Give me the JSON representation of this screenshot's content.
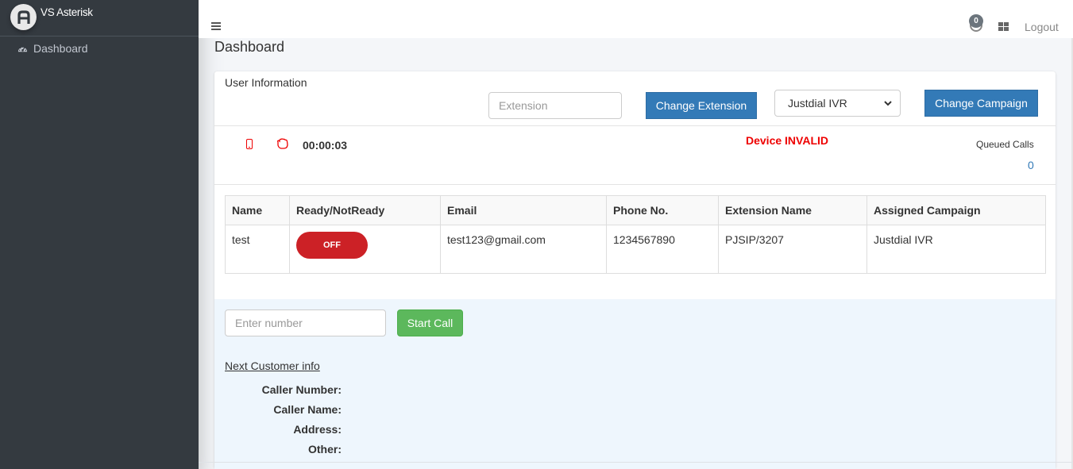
{
  "app": {
    "brand_name": "VS Asterisk",
    "brand_logo_letter": "A"
  },
  "sidebar": {
    "items": [
      {
        "label": "Dashboard",
        "icon": "tachometer-icon"
      }
    ]
  },
  "topbar": {
    "notification_count": "0",
    "logout_label": "Logout"
  },
  "page": {
    "title": "Dashboard"
  },
  "user_info": {
    "card_title": "User Information",
    "extension_placeholder": "Extension",
    "change_extension_label": "Change Extension",
    "campaign_selected": "Justdial IVR",
    "change_campaign_label": "Change Campaign",
    "timer": "00:00:03",
    "device_status": "Device INVALID",
    "queued_calls_label": "Queued Calls",
    "queued_calls_count": "0"
  },
  "colors": {
    "primary": "#337ab7",
    "success": "#5cb85c",
    "danger": "#cc2126",
    "status_red": "#ee0000",
    "sidebar_bg": "#343a40"
  },
  "table": {
    "headers": [
      "Name",
      "Ready/NotReady",
      "Email",
      "Phone No.",
      "Extension Name",
      "Assigned Campaign"
    ],
    "rows": [
      {
        "name": "test",
        "ready_state": "OFF",
        "email": "test123@gmail.com",
        "phone": "1234567890",
        "extension": "PJSIP/3207",
        "campaign": "Justdial IVR"
      }
    ]
  },
  "call": {
    "number_placeholder": "Enter number",
    "start_call_label": "Start Call",
    "next_customer_label": "Next Customer info",
    "fields": [
      {
        "label": "Caller Number:",
        "value": ""
      },
      {
        "label": "Caller Name:",
        "value": ""
      },
      {
        "label": "Address:",
        "value": ""
      },
      {
        "label": "Other:",
        "value": ""
      }
    ]
  }
}
